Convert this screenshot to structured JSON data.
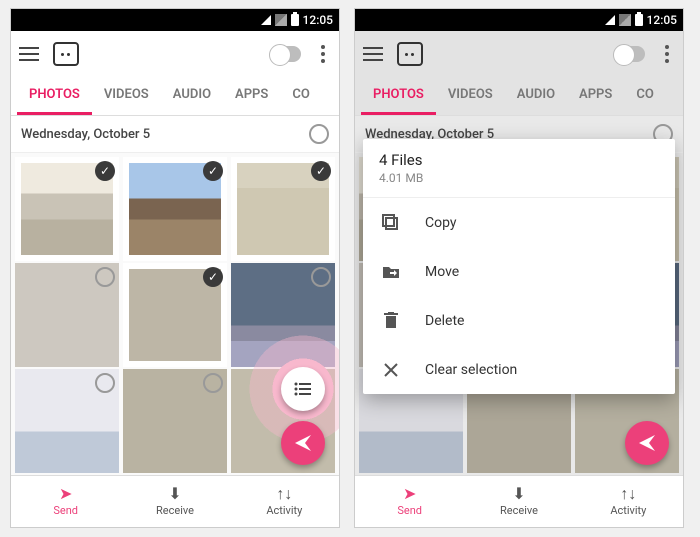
{
  "status": {
    "time": "12:05"
  },
  "tabs": [
    "PHOTOS",
    "VIDEOS",
    "AUDIO",
    "APPS",
    "CO"
  ],
  "active_tab_index": 0,
  "section": {
    "title": "Wednesday, October 5"
  },
  "bottom": [
    {
      "label": "Send",
      "active": true
    },
    {
      "label": "Receive",
      "active": false
    },
    {
      "label": "Activity",
      "active": false
    }
  ],
  "selection_menu": {
    "title": "4 Files",
    "subtitle": "4.01 MB",
    "items": [
      {
        "key": "copy",
        "label": "Copy"
      },
      {
        "key": "move",
        "label": "Move"
      },
      {
        "key": "delete",
        "label": "Delete"
      },
      {
        "key": "clear",
        "label": "Clear selection"
      }
    ]
  },
  "grid": {
    "items": [
      {
        "selected": true
      },
      {
        "selected": true
      },
      {
        "selected": true
      },
      {
        "selected": false
      },
      {
        "selected": true
      },
      {
        "selected": false
      },
      {
        "selected": false
      },
      {
        "selected": false
      },
      {
        "selected": false
      }
    ]
  }
}
